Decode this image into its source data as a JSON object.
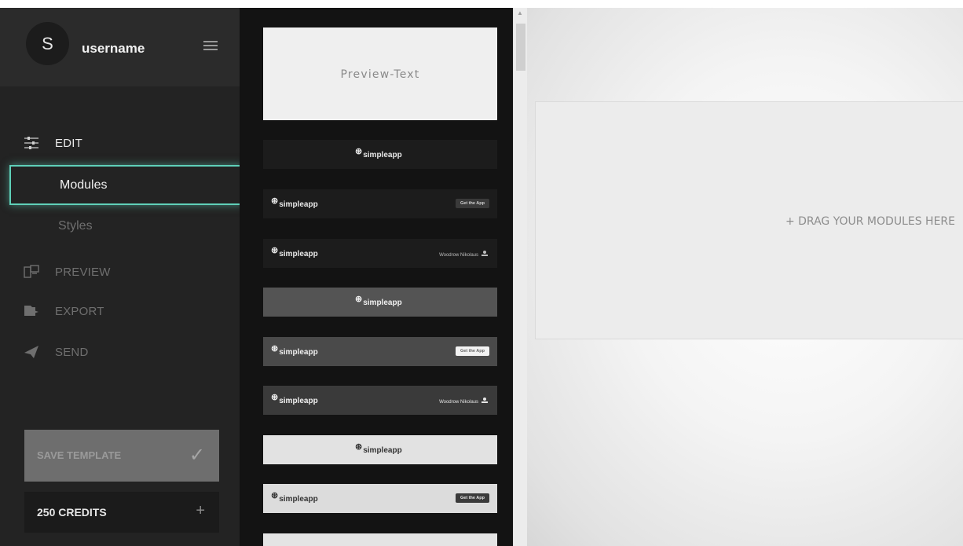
{
  "user": {
    "avatar_initial": "S",
    "username": "username"
  },
  "nav": {
    "edit": "EDIT",
    "modules": "Modules",
    "styles": "Styles",
    "preview": "PREVIEW",
    "export": "EXPORT",
    "send": "SEND"
  },
  "actions": {
    "save_template": "SAVE TEMPLATE",
    "save_icon": "✓",
    "credits": "250 CREDITS",
    "credits_plus": "+"
  },
  "modules": {
    "preview_text": "Preview-Text",
    "brand": "simpleapp",
    "brand_mark": "⊛",
    "cta": "Get the App",
    "author": "Woodrow Nikolaus"
  },
  "canvas": {
    "drop_hint": "+ DRAG YOUR MODULES HERE"
  },
  "colors": {
    "accent": "#5fd0b9",
    "sidebar_bg": "#232323",
    "modlist_bg": "#131313"
  }
}
